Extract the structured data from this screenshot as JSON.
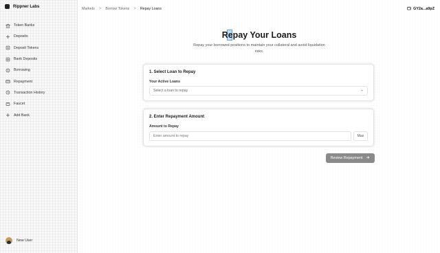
{
  "app": {
    "brand": "Rippner Labs"
  },
  "sidebar": {
    "items": [
      {
        "label": "Token Banks",
        "icon": "bank-icon"
      },
      {
        "label": "Deposits",
        "icon": "plus-icon"
      },
      {
        "label": "Deposit Tokens",
        "icon": "list-icon"
      },
      {
        "label": "Bank Deposits",
        "icon": "grid-icon"
      },
      {
        "label": "Borrowing",
        "icon": "coin-icon"
      },
      {
        "label": "Repayment",
        "icon": "card-icon"
      },
      {
        "label": "Transaction History",
        "icon": "history-icon"
      },
      {
        "label": "Faucet",
        "icon": "faucet-icon"
      },
      {
        "label": "Add Bank",
        "icon": "plus-icon"
      }
    ],
    "user": {
      "name": "New User"
    }
  },
  "header": {
    "breadcrumbs": [
      "Markets",
      "Borrow Tokens",
      "Repay Loans"
    ],
    "separator": ">",
    "wallet": "GY2a...a9pZ"
  },
  "page": {
    "title": "Repay Your Loans",
    "subtitle": "Repay your borrowed positions to maintain your collateral and avoid liquidation risks."
  },
  "select_section": {
    "title": "1. Select Loan to Repay",
    "label": "Your Active Loans",
    "placeholder": "Select a loan to repay"
  },
  "amount_section": {
    "title": "2. Enter Repayment Amount",
    "label": "Amount to Repay",
    "placeholder": "Enter amount to repay",
    "max_label": "Max"
  },
  "actions": {
    "review_label": "Review Repayment"
  },
  "colors": {
    "review_button": "#8a8a8a",
    "focus_highlight": "#5aa7ea"
  }
}
